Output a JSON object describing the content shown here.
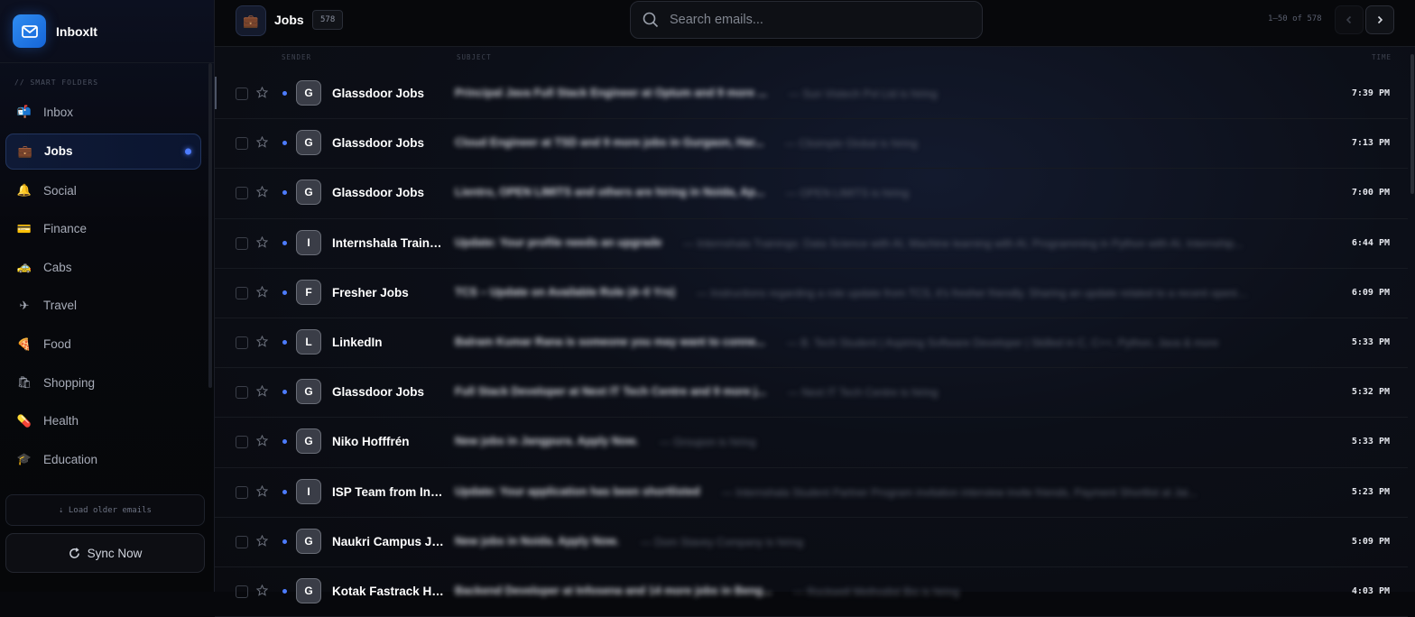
{
  "app": {
    "name": "InboxIt"
  },
  "sidebar": {
    "section_label": "// SMART FOLDERS",
    "folders": [
      {
        "label": "Inbox",
        "icon": "📬"
      },
      {
        "label": "Jobs",
        "icon": "💼",
        "active": true
      },
      {
        "label": "Social",
        "icon": "🔔"
      },
      {
        "label": "Finance",
        "icon": "💳"
      },
      {
        "label": "Cabs",
        "icon": "🚕"
      },
      {
        "label": "Travel",
        "icon": "✈"
      },
      {
        "label": "Food",
        "icon": "🍕"
      },
      {
        "label": "Shopping",
        "icon": "🛍"
      },
      {
        "label": "Health",
        "icon": "💊"
      },
      {
        "label": "Education",
        "icon": "🎓"
      }
    ],
    "load_older": "⇣ Load older emails",
    "sync": "Sync Now"
  },
  "header": {
    "folder_title": "Jobs",
    "count": "578",
    "search_placeholder": "Search emails...",
    "pager": "1–50 of 578"
  },
  "columns": {
    "sender": "SENDER",
    "subject": "SUBJECT",
    "time": "TIME"
  },
  "emails": [
    {
      "initial": "G",
      "sender": "Glassdoor Jobs",
      "subject": "Principal Java Full Stack Engineer at Optum and 9 more ...",
      "preview": "— Sun Vistech Pvt Ltd is hiring",
      "time": "7:39 PM"
    },
    {
      "initial": "G",
      "sender": "Glassdoor Jobs",
      "subject": "Cloud Engineer at TSD and 9 more jobs in Gurgaon, Har...",
      "preview": "— Clisimple Global is hiring",
      "time": "7:13 PM"
    },
    {
      "initial": "G",
      "sender": "Glassdoor Jobs",
      "subject": "Lientro, OPEN LIMITS and others are hiring in Noida, Ap...",
      "preview": "— OPEN LIMITS is hiring",
      "time": "7:00 PM"
    },
    {
      "initial": "I",
      "sender": "Internshala Trainings",
      "subject": "Update: Your profile needs an upgrade",
      "preview": "— Internshala Trainings: Data Science with AI, Machine learning with AI, Programming in Python with AI, Internship...",
      "time": "6:44 PM"
    },
    {
      "initial": "F",
      "sender": "Fresher Jobs",
      "subject": "TCS – Update on Available Role (4–0 Yrs)",
      "preview": "— Instructions regarding a role update from TCS, it's fresher friendly. Sharing an update related to a recent opening...",
      "time": "6:09 PM"
    },
    {
      "initial": "L",
      "sender": "LinkedIn",
      "subject": "Balram Kumar Rana is someone you may want to conne...",
      "preview": "— B. Tech Student | Aspiring Software Developer | Skilled in C, C++, Python, Java & more",
      "time": "5:33 PM"
    },
    {
      "initial": "G",
      "sender": "Glassdoor Jobs",
      "subject": "Full Stack Developer at Next IT Tech Centre and 9 more j...",
      "preview": "— Next IT Tech Centre is hiring",
      "time": "5:32 PM"
    },
    {
      "initial": "G",
      "sender": "Niko Hofffrén",
      "subject": "New jobs in Jangpura. Apply Now.",
      "preview": "— Groupon is hiring",
      "time": "5:33 PM"
    },
    {
      "initial": "I",
      "sender": "ISP Team from Internshala",
      "subject": "Update: Your application has been shortlisted",
      "preview": "— Internshala Student Partner Program invitation interview invite friends, Payment Shortlist at Jai...",
      "time": "5:23 PM"
    },
    {
      "initial": "G",
      "sender": "Naukri Campus Jobs",
      "subject": "New jobs in Noida. Apply Now.",
      "preview": "— Dom Stavey Company is hiring",
      "time": "5:09 PM"
    },
    {
      "initial": "G",
      "sender": "Kotak Fastrack Hiring",
      "subject": "Backend Developer at Infosena and 14 more jobs in Beng...",
      "preview": "— Rockwell Methodist Bio is hiring",
      "time": "4:03 PM"
    }
  ]
}
